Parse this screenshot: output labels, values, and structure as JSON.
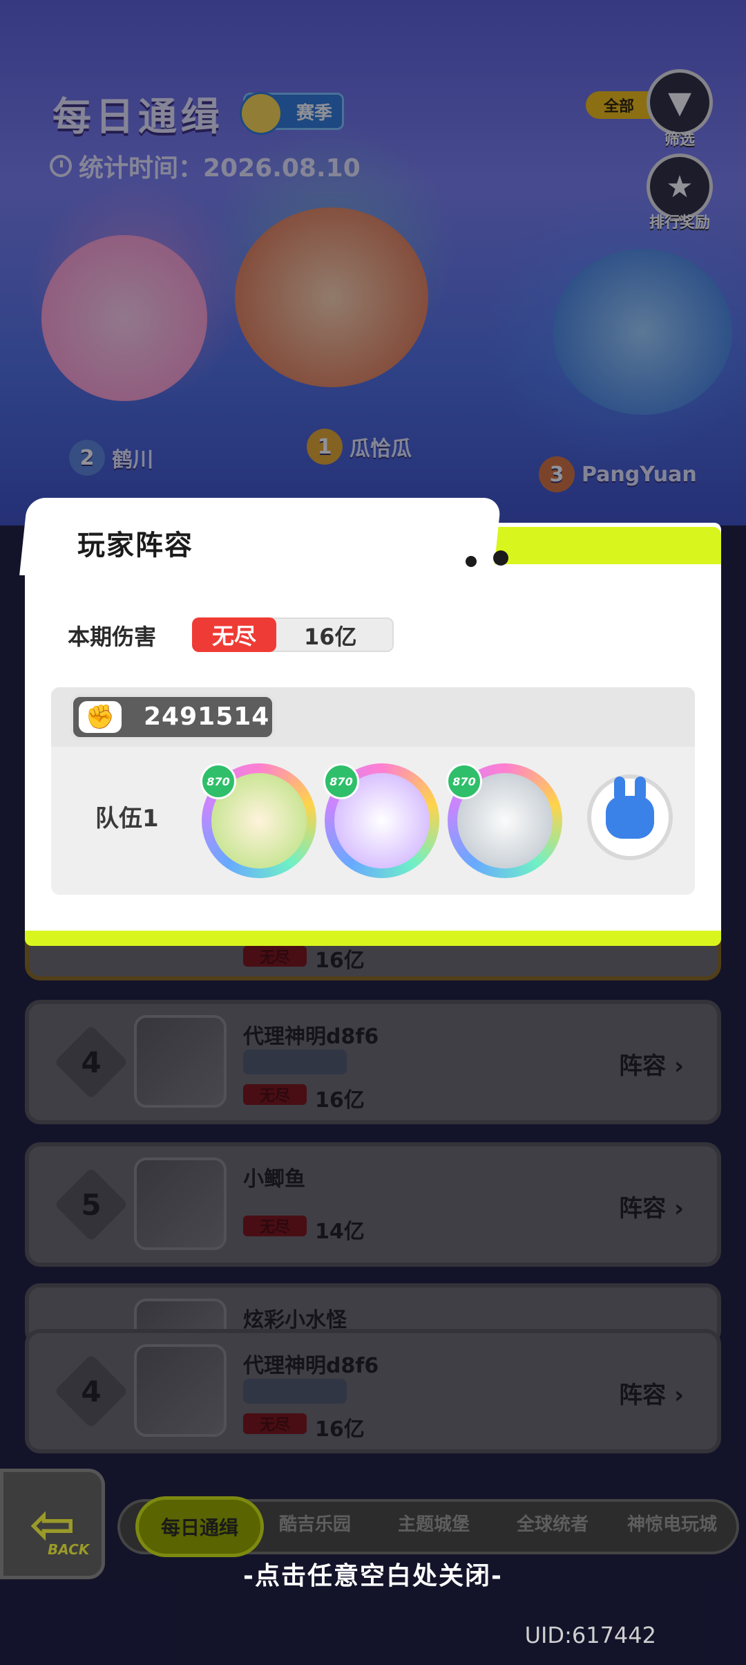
{
  "header": {
    "title": "每日通缉",
    "season_label": "赛季",
    "stat_time": "统计时间：2026.08.10",
    "filter_all": "全部",
    "filter_label": "筛选",
    "reward_label": "排行奖励"
  },
  "podium": [
    {
      "rank": "2",
      "name": "鹤川"
    },
    {
      "rank": "1",
      "name": "瓜恰瓜"
    },
    {
      "rank": "3",
      "name": "PangYuan"
    }
  ],
  "modal": {
    "title": "玩家阵容",
    "damage_label": "本期伤害",
    "damage_tag": "无尽",
    "damage_value": "16亿",
    "power": "2491514",
    "team_label": "队伍1",
    "hero_level": "870"
  },
  "rows": [
    {
      "rank": "4",
      "name": "代理神明d8f6",
      "tag": "无尽",
      "damage": "16亿",
      "action": "阵容"
    },
    {
      "rank": "5",
      "name": "小鲫鱼",
      "tag": "无尽",
      "damage": "14亿",
      "action": "阵容"
    },
    {
      "name": "炫彩小水怪"
    },
    {
      "rank": "4",
      "name": "代理神明d8f6",
      "tag": "无尽",
      "damage": "16亿",
      "action": "阵容"
    }
  ],
  "behind_row": {
    "tag": "无尽",
    "damage": "16亿"
  },
  "nav": {
    "back": "BACK",
    "tabs": [
      "每日通缉",
      "酷吉乐园",
      "主题城堡",
      "全球统者",
      "神惊电玩城"
    ]
  },
  "close_hint": "-点击任意空白处关闭-",
  "uid": "UID:617442",
  "colors": {
    "accent_lime": "#d9f51e",
    "tag_red": "#ef3b35"
  }
}
